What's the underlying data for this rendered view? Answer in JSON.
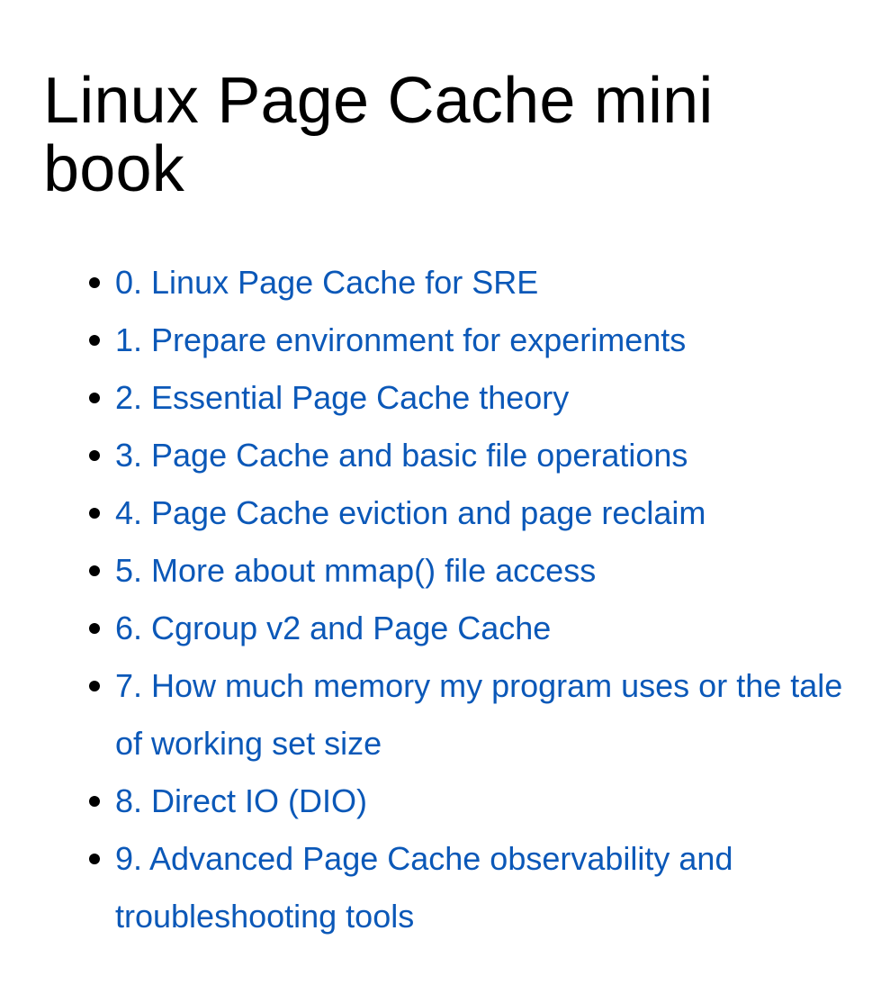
{
  "page": {
    "title": "Linux Page Cache mini book"
  },
  "toc": {
    "items": [
      {
        "label": "0. Linux Page Cache for SRE"
      },
      {
        "label": "1. Prepare environment for experiments"
      },
      {
        "label": "2. Essential Page Cache theory"
      },
      {
        "label": "3. Page Cache and basic file operations"
      },
      {
        "label": "4. Page Cache eviction and page reclaim"
      },
      {
        "label": "5. More about mmap() file access"
      },
      {
        "label": "6. Cgroup v2 and Page Cache"
      },
      {
        "label": "7. How much memory my program uses or the tale of working set size"
      },
      {
        "label": "8. Direct IO (DIO)"
      },
      {
        "label": "9. Advanced Page Cache observability and troubleshooting tools"
      }
    ]
  },
  "colors": {
    "link": "#0b58b8",
    "title": "#000000",
    "bullet": "#000000",
    "background": "#ffffff"
  }
}
